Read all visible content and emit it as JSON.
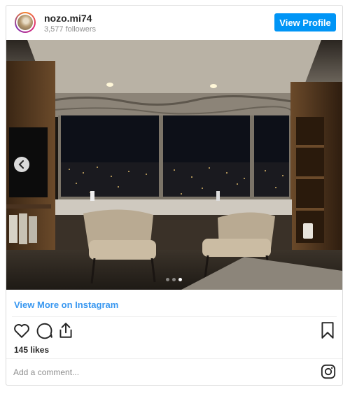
{
  "post": {
    "username": "nozo.mi74",
    "followers": "3,577 followers",
    "view_profile_label": "View Profile",
    "view_more_label": "View More on Instagram",
    "likes": "145 likes",
    "comment_placeholder": "Add a comment...",
    "carousel": {
      "current_slide": 3,
      "total_slides": 3
    }
  },
  "colors": {
    "accent": "#0095f6",
    "link": "#3897f0",
    "muted": "#8e8e8e"
  },
  "icons": [
    "previous-slide-icon",
    "heart-icon",
    "comment-icon",
    "share-icon",
    "bookmark-icon",
    "instagram-logo-icon"
  ]
}
